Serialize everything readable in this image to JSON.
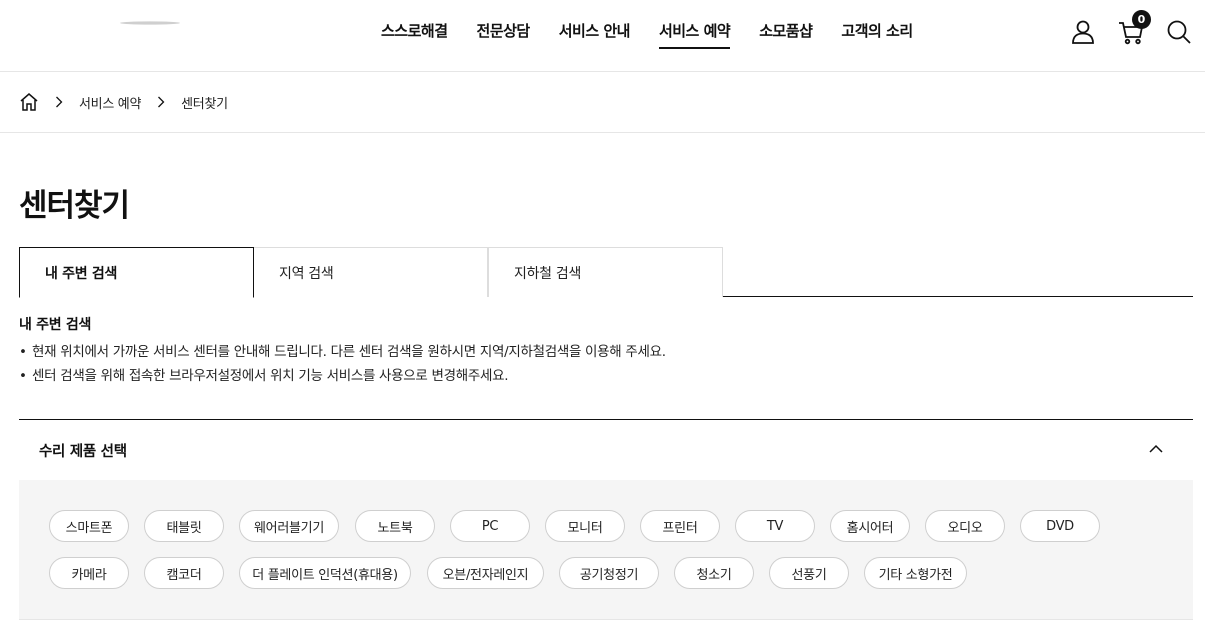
{
  "header": {
    "nav": [
      "스스로해결",
      "전문상담",
      "서비스 안내",
      "서비스 예약",
      "소모품샵",
      "고객의 소리"
    ],
    "active_nav": "서비스 예약",
    "cart_count": "0",
    "icons": [
      "user-icon",
      "cart-icon",
      "search-icon"
    ]
  },
  "breadcrumb": {
    "home_icon": "home-icon",
    "items": [
      "서비스 예약",
      "센터찾기"
    ]
  },
  "page_title": "센터찾기",
  "tabs": [
    {
      "label": "내 주변 검색",
      "active": true
    },
    {
      "label": "지역 검색",
      "active": false
    },
    {
      "label": "지하철 검색",
      "active": false
    }
  ],
  "info": {
    "title": "내 주변 검색",
    "bullets": [
      "현재 위치에서 가까운 서비스 센터를 안내해 드립니다. 다른 센터 검색을 원하시면 지역/지하철검색을 이용해 주세요.",
      "센터 검색을 위해 접속한 브라우저설정에서 위치 기능 서비스를 사용으로 변경해주세요."
    ]
  },
  "product_select": {
    "title": "수리 제품 선택",
    "expanded": true,
    "row1": [
      "스마트폰",
      "태블릿",
      "웨어러블기기",
      "노트북",
      "PC",
      "모니터",
      "프린터",
      "TV",
      "홈시어터",
      "오디오",
      "DVD"
    ],
    "row2": [
      "카메라",
      "캠코더",
      "더 플레이트 인덕션(휴대용)",
      "오븐/전자레인지",
      "공기청정기",
      "청소기",
      "선풍기",
      "기타 소형가전"
    ]
  },
  "colors": {
    "text": "#111111",
    "border": "#dddddd",
    "panel_bg": "#f5f5f5"
  }
}
